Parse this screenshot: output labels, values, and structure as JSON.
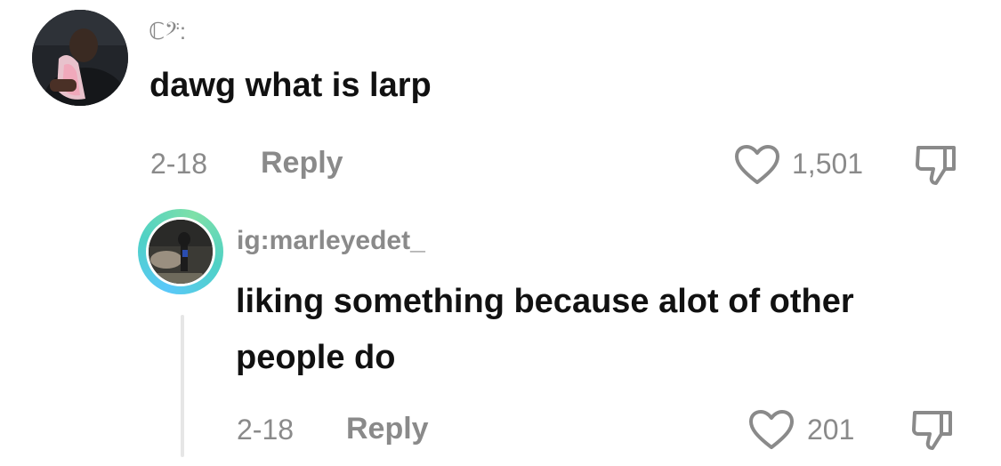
{
  "comment": {
    "username": "ℂ𝄢:",
    "text": "dawg what is larp",
    "date": "2-18",
    "reply_label": "Reply",
    "likes": "1,501"
  },
  "reply_comment": {
    "username": "ig:marleyedet_",
    "text": "liking something because alot of other people do",
    "date": "2-18",
    "reply_label": "Reply",
    "likes": "201"
  },
  "icons": {
    "like": "heart-outline-icon",
    "dislike": "thumbs-down-icon"
  },
  "colors": {
    "text_primary": "#111111",
    "text_secondary": "#8a8a8a",
    "story_ring": "#5ac8fa"
  }
}
